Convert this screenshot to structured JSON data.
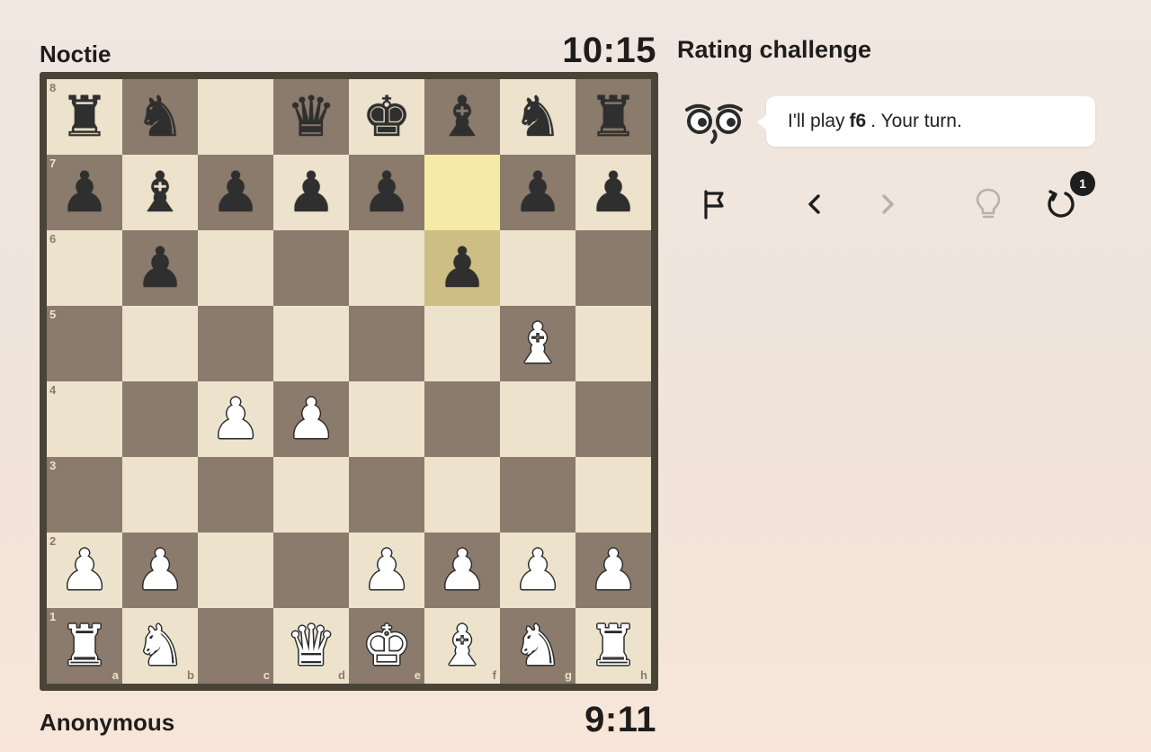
{
  "top_player": {
    "name": "Noctie",
    "clock": "10:15"
  },
  "bottom_player": {
    "name": "Anonymous",
    "clock": "9:11"
  },
  "mode_title": "Rating challenge",
  "message": {
    "prefix": "I'll play",
    "move": "f6",
    "suffix": ". Your turn."
  },
  "controls": {
    "resign": "flag-icon",
    "back": "chevron-left-icon",
    "forward": "chevron-right-icon",
    "hint": "lightbulb-icon",
    "takeback": "undo-icon",
    "takeback_count": "1"
  },
  "board": {
    "ranks": [
      "8",
      "7",
      "6",
      "5",
      "4",
      "3",
      "2",
      "1"
    ],
    "files": [
      "a",
      "b",
      "c",
      "d",
      "e",
      "f",
      "g",
      "h"
    ],
    "highlighted_squares": [
      "f7",
      "f6"
    ],
    "position": [
      [
        "br",
        "bn",
        "",
        "bq",
        "bk",
        "bb",
        "bn",
        "br"
      ],
      [
        "bp",
        "bb",
        "bp",
        "bp",
        "bp",
        "",
        "bp",
        "bp"
      ],
      [
        "",
        "bp",
        "",
        "",
        "",
        "bp",
        "",
        ""
      ],
      [
        "",
        "",
        "",
        "",
        "",
        "",
        "wb",
        ""
      ],
      [
        "",
        "",
        "wp",
        "wp",
        "",
        "",
        "",
        ""
      ],
      [
        "",
        "",
        "",
        "",
        "",
        "",
        "",
        ""
      ],
      [
        "wp",
        "wp",
        "",
        "",
        "wp",
        "wp",
        "wp",
        "wp"
      ],
      [
        "wr",
        "wn",
        "",
        "wq",
        "wk",
        "wb",
        "wn",
        "wr"
      ]
    ]
  },
  "colors": {
    "light_square": "#ede3cc",
    "dark_square": "#8a7b6c",
    "highlight": "#f6eaa9",
    "frame": "#4a4438"
  }
}
